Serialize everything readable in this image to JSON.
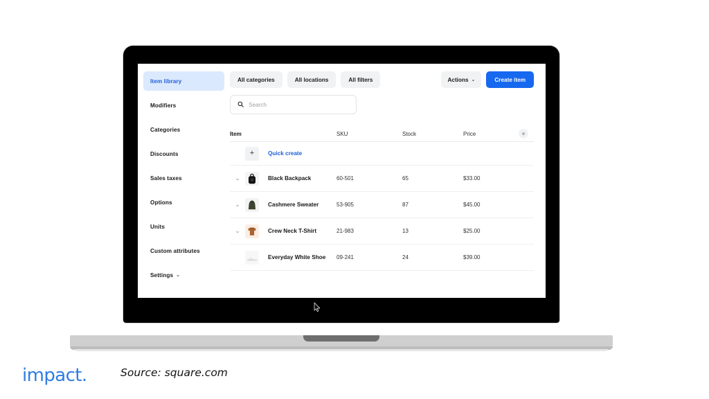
{
  "sidebar": {
    "items": [
      {
        "label": "Item library",
        "active": true,
        "caret": false
      },
      {
        "label": "Modifiers",
        "active": false,
        "caret": false
      },
      {
        "label": "Categories",
        "active": false,
        "caret": false
      },
      {
        "label": "Discounts",
        "active": false,
        "caret": false
      },
      {
        "label": "Sales taxes",
        "active": false,
        "caret": false
      },
      {
        "label": "Options",
        "active": false,
        "caret": false
      },
      {
        "label": "Units",
        "active": false,
        "caret": false
      },
      {
        "label": "Custom attributes",
        "active": false,
        "caret": false
      },
      {
        "label": "Settings",
        "active": false,
        "caret": true
      }
    ],
    "caret_glyph": "⌄"
  },
  "toolbar": {
    "filters": [
      {
        "label": "All categories"
      },
      {
        "label": "All locations"
      },
      {
        "label": "All filters"
      }
    ],
    "actions_label": "Actions",
    "actions_caret": "⌄",
    "create_item_label": "Create item"
  },
  "search": {
    "placeholder": "Search",
    "value": "",
    "icon": "search-icon"
  },
  "table": {
    "headers": {
      "item": "Item",
      "sku": "SKU",
      "stock": "Stock",
      "price": "Price",
      "add": "+"
    },
    "quick_create": {
      "label": "Quick create",
      "plus": "+"
    },
    "chevron_glyph": "⌄",
    "rows": [
      {
        "name": "Black Backpack",
        "sku": "60-501",
        "stock": "65",
        "price": "$33.00",
        "expandable": true,
        "thumb": "backpack"
      },
      {
        "name": "Cashmere Sweater",
        "sku": "53-905",
        "stock": "87",
        "price": "$45.00",
        "expandable": true,
        "thumb": "sweater"
      },
      {
        "name": "Crew Neck T-Shirt",
        "sku": "21-983",
        "stock": "13",
        "price": "$25.00",
        "expandable": true,
        "thumb": "tshirt"
      },
      {
        "name": "Everyday White Shoe",
        "sku": "09-241",
        "stock": "24",
        "price": "$39.00",
        "expandable": false,
        "thumb": "shoe"
      }
    ]
  },
  "footer": {
    "brand": "impact",
    "brand_dot": ".",
    "source": "Source: square.com"
  },
  "colors": {
    "accent_blue": "#1668ef",
    "link_blue": "#1f5fd6",
    "active_nav_bg": "#dbe9fe",
    "pill_bg": "#f1f2f3",
    "brand_blue": "#2f7de1"
  }
}
